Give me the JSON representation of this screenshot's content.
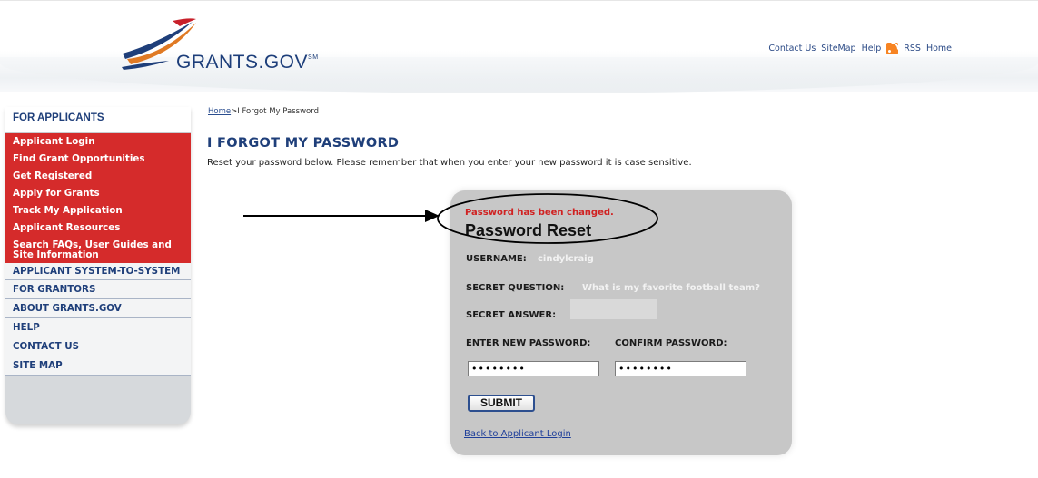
{
  "header": {
    "logo_text": "GRANTS.GOV",
    "logo_mark": "SM",
    "links": [
      "Contact Us",
      "SiteMap",
      "Help",
      "RSS",
      "Home"
    ]
  },
  "sidebar": {
    "heading": "FOR APPLICANTS",
    "red_items": [
      "Applicant Login",
      "Find Grant Opportunities",
      "Get Registered",
      "Apply for Grants",
      "Track My Application",
      "Applicant Resources",
      "Search FAQs, User Guides and Site Information"
    ],
    "gray_items": [
      "APPLICANT SYSTEM-TO-SYSTEM",
      "FOR GRANTORS",
      "ABOUT GRANTS.GOV",
      "HELP",
      "CONTACT US",
      "SITE MAP"
    ]
  },
  "breadcrumb": {
    "home": "Home",
    "separator": ">",
    "current": "I Forgot My Password"
  },
  "page": {
    "title": "I FORGOT MY PASSWORD",
    "intro": "Reset your password below. Please remember that when you enter your new password it is case sensitive."
  },
  "form": {
    "success_message": "Password has been changed.",
    "title": "Password Reset",
    "username_label": "USERNAME:",
    "username_value": "cindylcraig",
    "question_label": "SECRET QUESTION:",
    "question_value": "What is my favorite football team?",
    "answer_label": "SECRET ANSWER:",
    "new_password_label": "ENTER NEW PASSWORD:",
    "confirm_password_label": "CONFIRM PASSWORD:",
    "new_password_value": "••••••••",
    "confirm_password_value": "••••••••",
    "submit_label": "SUBMIT",
    "back_link": "Back to Applicant Login"
  },
  "colors": {
    "brand_blue": "#1f3f7a",
    "nav_red": "#d52b2b",
    "panel_gray": "#c7c7c7",
    "success_red": "#d02222",
    "rss_orange": "#f78422"
  },
  "icons": [
    "grants-gov-swoosh-logo",
    "rss-icon",
    "annotation-arrow",
    "annotation-ellipse"
  ]
}
